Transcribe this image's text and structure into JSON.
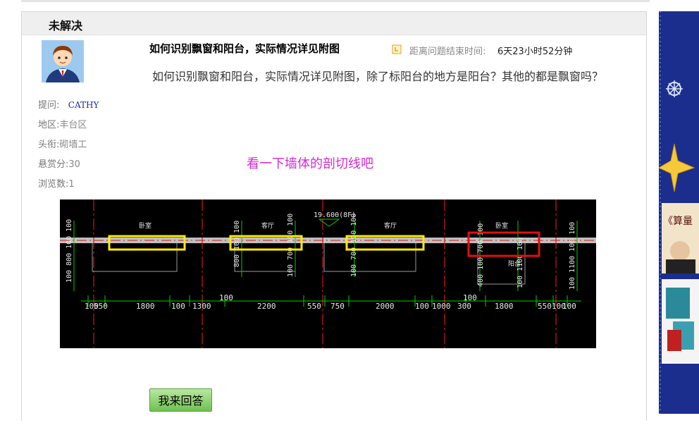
{
  "question": {
    "status": "未解决",
    "title": "如何识别飘窗和阳台，实际情况详见附图",
    "time_label": "距离问题结束时间:",
    "time_value": "6天23小时52分钟",
    "body": "如何识别飘窗和阳台，实际情况详见附图，除了标阳台的地方是阳台？其他的都是飘窗吗？",
    "hint": "看一下墙体的剖切线吧"
  },
  "asker": {
    "asker_label": "提问:",
    "asker_name": "CATHY",
    "region_label": "地区:",
    "region_value": "丰台区",
    "rank_label": "头衔:",
    "rank_value": "砌墙工",
    "reward_label": "悬赏分:",
    "reward_value": "30",
    "views_label": "浏览数:",
    "views_value": "1"
  },
  "drawing": {
    "elevation": "19.600(8F)",
    "room_labels": [
      "卧室",
      "客厅",
      "客厅",
      "卧室",
      "阳台"
    ],
    "dimensions": [
      "100",
      "550",
      "1800",
      "100",
      "1300",
      "100",
      "2200",
      "550",
      "750",
      "2000",
      "100",
      "1000",
      "300",
      "100",
      "1800",
      "550",
      "100",
      "100"
    ],
    "vertical_dims": [
      "100 800 100 100",
      "800 100 100",
      "100 700 100 100",
      "100 700 100 100",
      "400 100 700 100",
      "100 1100 100",
      "100 1100 100 100"
    ]
  },
  "actions": {
    "answer_button": "我来回答"
  },
  "colors": {
    "hint": "#d42bd4",
    "yellow_box": "#ffeb00",
    "red_box": "#e01010",
    "dimension": "#00d000"
  }
}
